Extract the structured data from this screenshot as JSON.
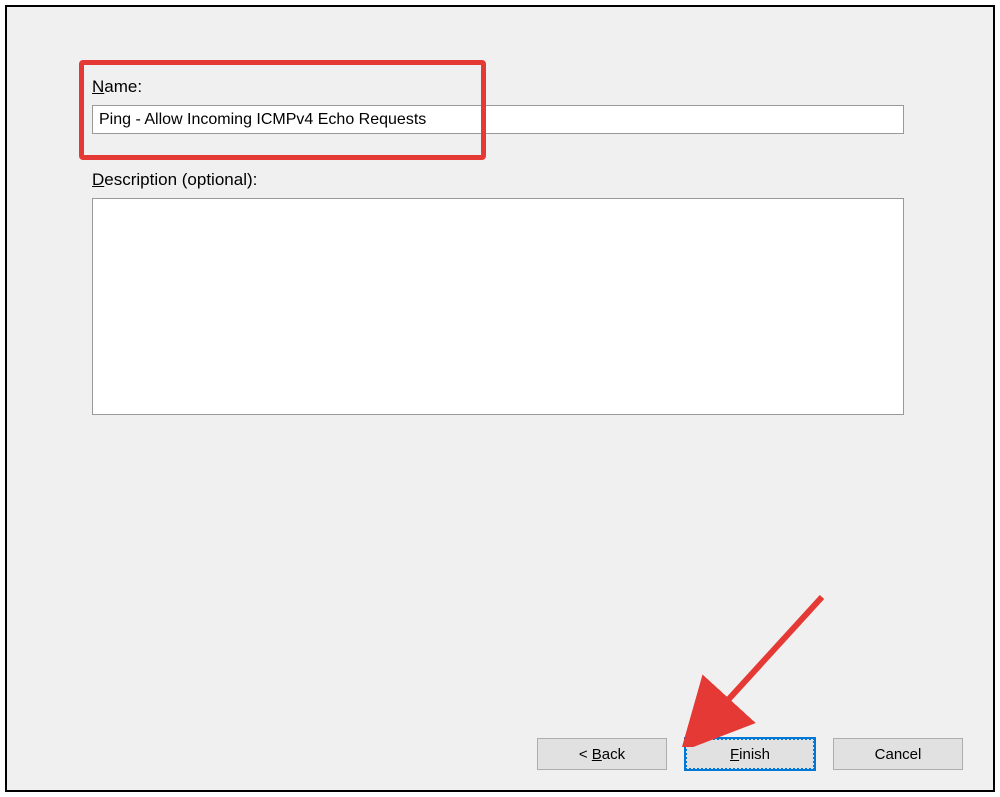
{
  "form": {
    "name_label_underlined": "N",
    "name_label_rest": "ame:",
    "name_value": "Ping - Allow Incoming ICMPv4 Echo Requests",
    "desc_label_underlined": "D",
    "desc_label_rest": "escription (optional):",
    "desc_value": ""
  },
  "buttons": {
    "back_prefix": "< ",
    "back_underlined": "B",
    "back_rest": "ack",
    "finish_underlined": "F",
    "finish_rest": "inish",
    "cancel": "Cancel"
  },
  "annotations": {
    "highlight": "name-section",
    "arrow_target": "finish-button"
  }
}
